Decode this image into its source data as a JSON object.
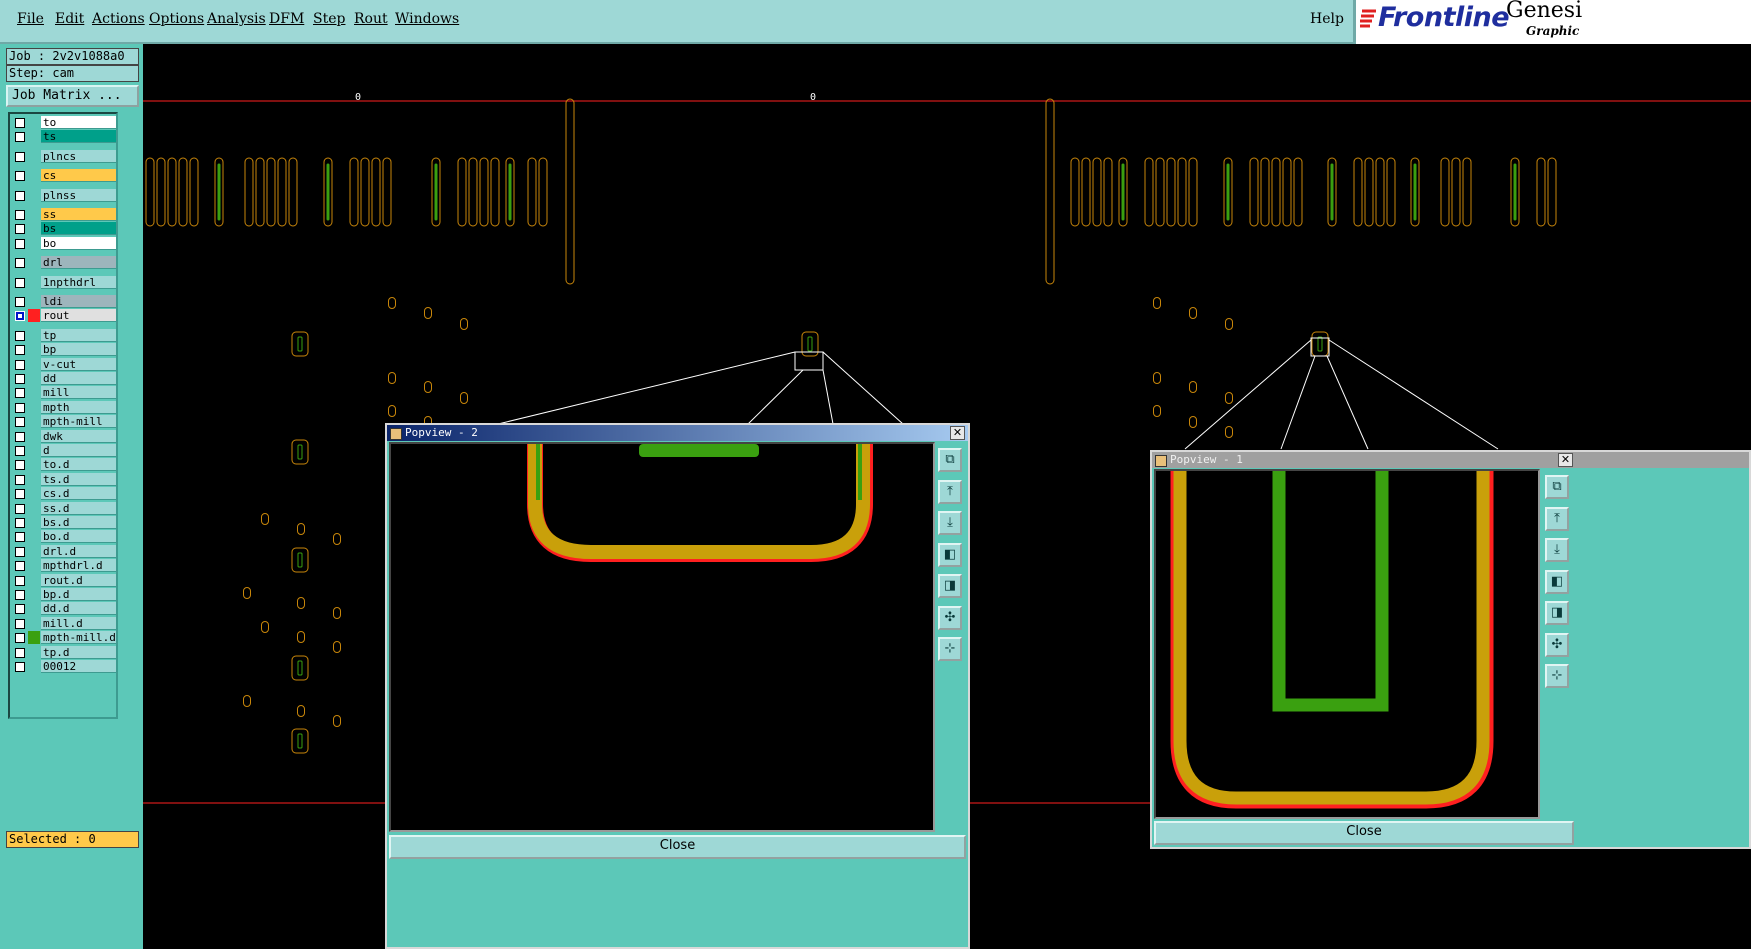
{
  "menu": {
    "items": [
      "File",
      "Edit",
      "Actions",
      "Options",
      "Analysis",
      "DFM",
      "Step",
      "Rout",
      "Windows"
    ],
    "help": "Help"
  },
  "brand": {
    "logo": "Frontline",
    "product": "Genesi",
    "sub": "Graphic"
  },
  "job": {
    "job_line": "Job : 2v2v1088a0",
    "step_line": "Step: cam"
  },
  "job_matrix_label": "Job Matrix ...",
  "layers": [
    {
      "name": "to",
      "color": "#ffffff",
      "group": 0
    },
    {
      "name": "ts",
      "color": "#00a08a",
      "group": 0
    },
    {
      "name": "plncs",
      "color": "#9ed8d6",
      "group": 1
    },
    {
      "name": "cs",
      "color": "#ffc94a",
      "group": 2
    },
    {
      "name": "plnss",
      "color": "#9ed8d6",
      "group": 3
    },
    {
      "name": "ss",
      "color": "#ffc94a",
      "group": 4
    },
    {
      "name": "bs",
      "color": "#00a08a",
      "group": 4
    },
    {
      "name": "bo",
      "color": "#ffffff",
      "group": 4
    },
    {
      "name": "drl",
      "color": "#9db5bc",
      "group": 5
    },
    {
      "name": "1npthdrl",
      "color": "#9ed8d6",
      "group": 6
    },
    {
      "name": "ldi",
      "color": "#9db5bc",
      "group": 7
    },
    {
      "name": "rout",
      "color": "#e0e0e0",
      "group": 7,
      "active": true,
      "swatch": "#ff2020"
    },
    {
      "name": "tp",
      "color": "#9ed8d6",
      "group": 8
    },
    {
      "name": "bp",
      "color": "#9ed8d6",
      "group": 8
    },
    {
      "name": "v-cut",
      "color": "#9ed8d6",
      "group": 8
    },
    {
      "name": "dd",
      "color": "#9ed8d6",
      "group": 8
    },
    {
      "name": "mill",
      "color": "#9ed8d6",
      "group": 8
    },
    {
      "name": "mpth",
      "color": "#9ed8d6",
      "group": 8
    },
    {
      "name": "mpth-mill",
      "color": "#9ed8d6",
      "group": 8
    },
    {
      "name": "dwk",
      "color": "#9ed8d6",
      "group": 8
    },
    {
      "name": "d",
      "color": "#9ed8d6",
      "group": 8
    },
    {
      "name": "to.d",
      "color": "#9ed8d6",
      "group": 8
    },
    {
      "name": "ts.d",
      "color": "#9ed8d6",
      "group": 8
    },
    {
      "name": "cs.d",
      "color": "#9ed8d6",
      "group": 8
    },
    {
      "name": "ss.d",
      "color": "#9ed8d6",
      "group": 8
    },
    {
      "name": "bs.d",
      "color": "#9ed8d6",
      "group": 8
    },
    {
      "name": "bo.d",
      "color": "#9ed8d6",
      "group": 8
    },
    {
      "name": "drl.d",
      "color": "#9ed8d6",
      "group": 8
    },
    {
      "name": "mpthdrl.d",
      "color": "#9ed8d6",
      "group": 8
    },
    {
      "name": "rout.d",
      "color": "#9ed8d6",
      "group": 8
    },
    {
      "name": "bp.d",
      "color": "#9ed8d6",
      "group": 8
    },
    {
      "name": "dd.d",
      "color": "#9ed8d6",
      "group": 8
    },
    {
      "name": "mill.d",
      "color": "#9ed8d6",
      "group": 8
    },
    {
      "name": "mpth-mill.d",
      "color": "#9ed8d6",
      "group": 8,
      "swatch": "#3aa010"
    },
    {
      "name": "tp.d",
      "color": "#9ed8d6",
      "group": 8
    },
    {
      "name": "00012",
      "color": "#9ed8d6",
      "group": 8
    }
  ],
  "selected": "Selected : 0",
  "canvas": {
    "marker_a": "0",
    "marker_b": "0"
  },
  "popview2": {
    "title": "Popview - 2",
    "close": "Close"
  },
  "popview1": {
    "title": "Popview - 1",
    "close": "Close"
  },
  "popview_buttons": [
    "copy-icon",
    "zoom-home-icon",
    "zoom-in-icon",
    "pan-left-icon",
    "pan-right-icon",
    "zoom-fit-icon",
    "zoom-center-icon"
  ],
  "colors": {
    "panel": "#5cc8b8",
    "panel_light": "#9ed8d6",
    "outline": "#c8860a",
    "pad": "#3aa010",
    "rout": "#ff2020",
    "trace": "#c9a00a"
  }
}
